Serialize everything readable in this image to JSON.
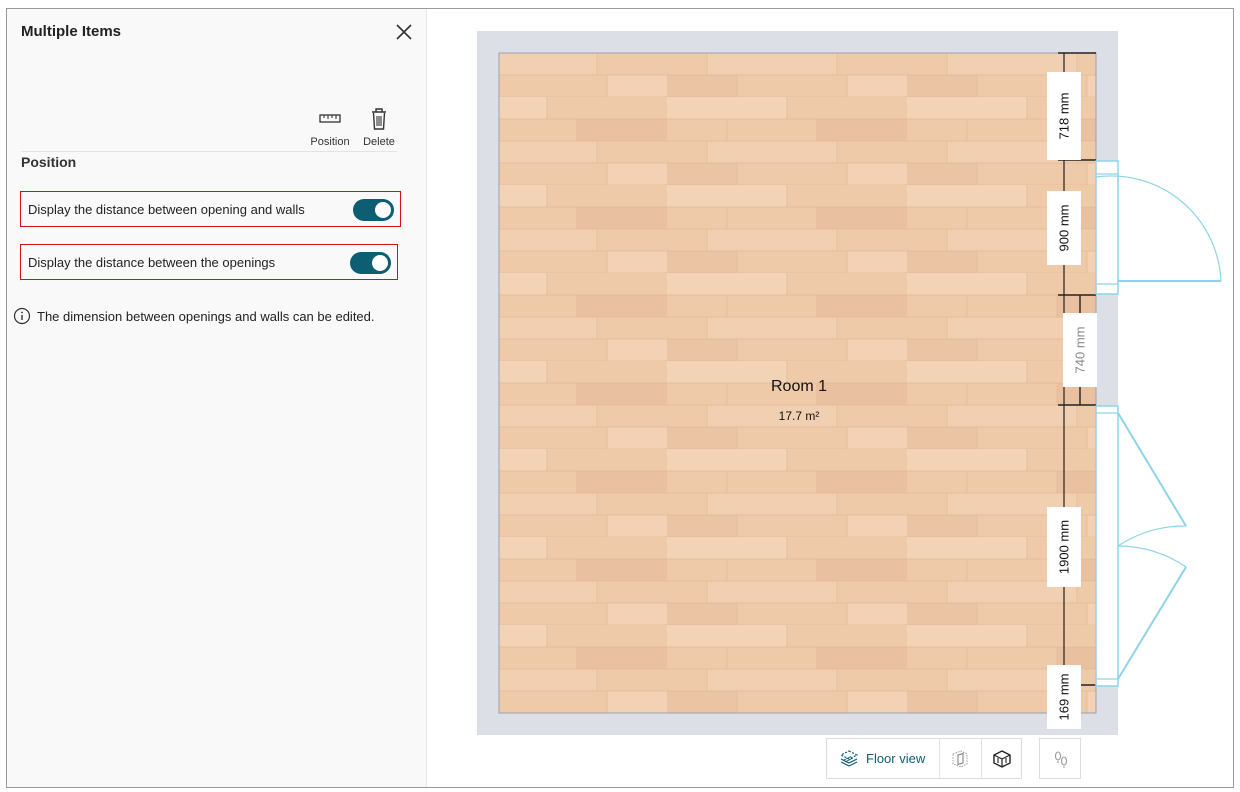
{
  "panel": {
    "title": "Multiple Items",
    "tools": [
      {
        "label": "Position",
        "icon": "ruler-icon"
      },
      {
        "label": "Delete",
        "icon": "trash-icon"
      }
    ],
    "section_title": "Position",
    "options": [
      {
        "label": "Display the distance between opening and walls",
        "enabled": true
      },
      {
        "label": "Display the distance between the openings",
        "enabled": true
      }
    ],
    "info_text": "The dimension between openings and walls can be edited."
  },
  "plan": {
    "room_name": "Room 1",
    "room_area": "17.7 m²",
    "dimensions": [
      "718 mm",
      "900 mm",
      "740 mm",
      "1900 mm",
      "169 mm"
    ]
  },
  "viewbar": {
    "floor_view_label": "Floor view",
    "icons": [
      "floor-view-icon",
      "wall-view-icon",
      "3d-view-icon",
      "walk-view-icon"
    ]
  },
  "colors": {
    "accent": "#0d5e72",
    "highlight_border": "#d0121b",
    "floor": "#efcaa9",
    "wall": "#dcdfe6",
    "opening": "#8fd3ea"
  }
}
